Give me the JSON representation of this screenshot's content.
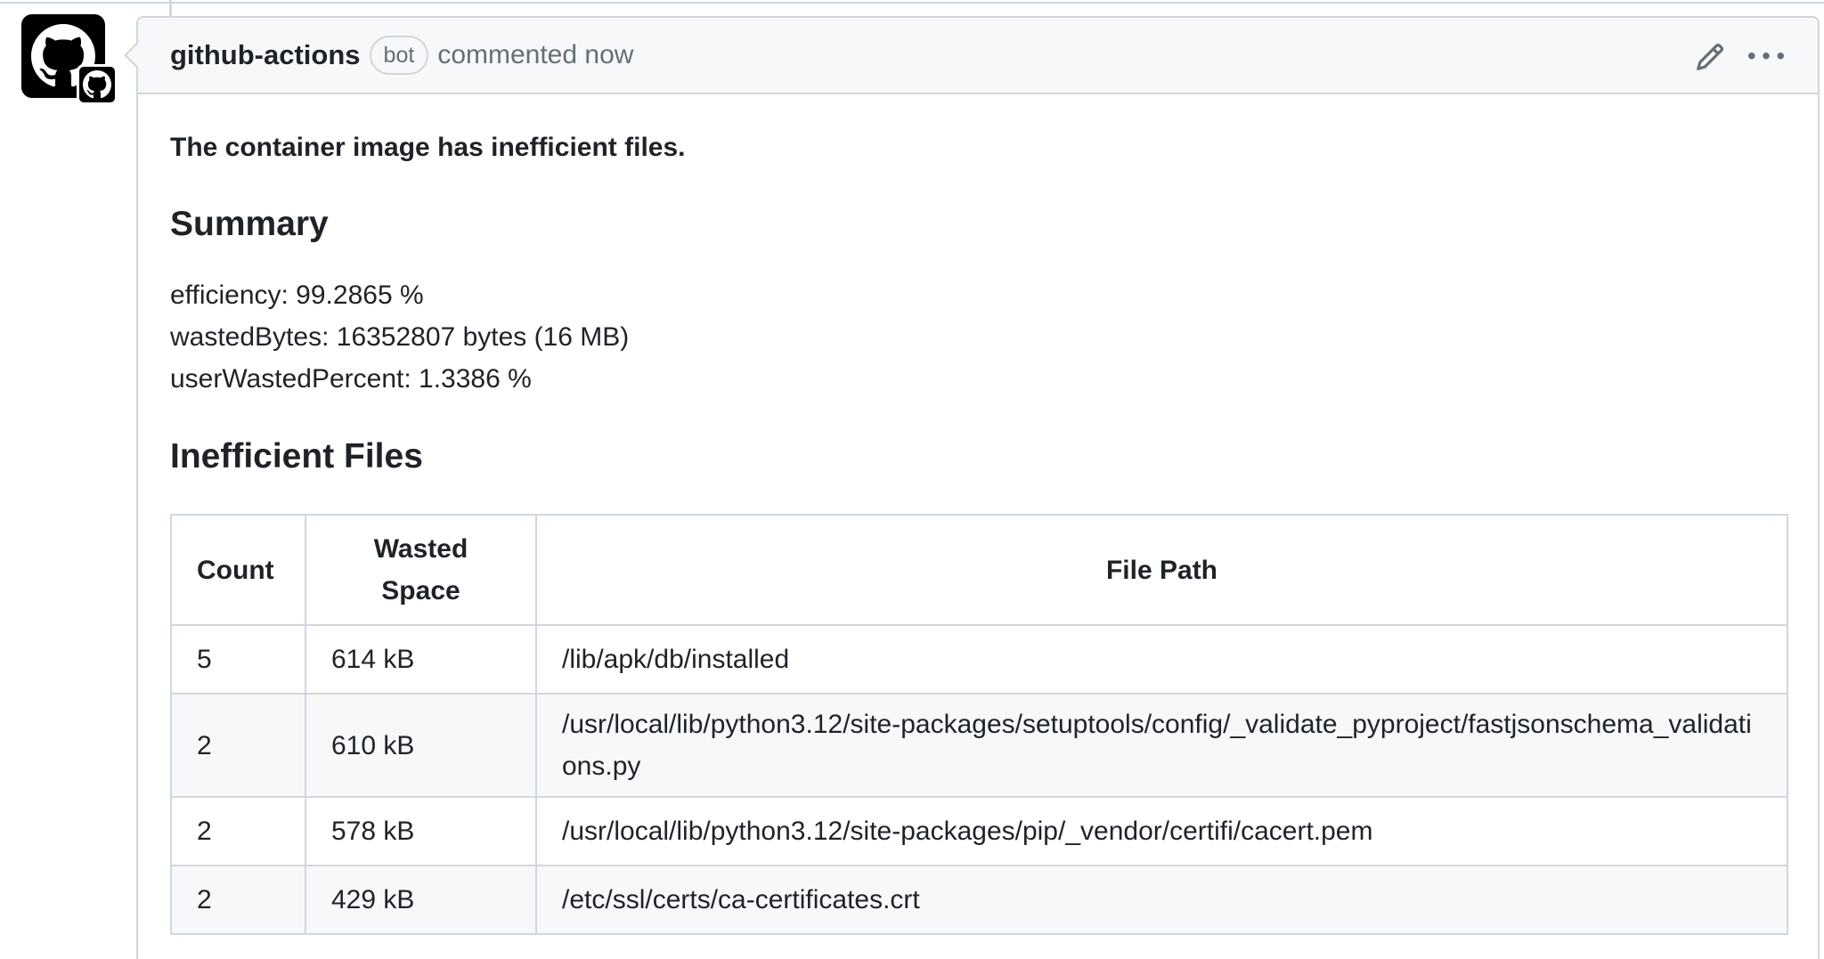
{
  "comment": {
    "author": "github-actions",
    "author_badge": "bot",
    "meta": "commented now",
    "lead": "The container image has inefficient files.",
    "summary_heading": "Summary",
    "metrics": [
      "efficiency: 99.2865 %",
      "wastedBytes: 16352807 bytes (16 MB)",
      "userWastedPercent: 1.3386 %"
    ],
    "files_heading": "Inefficient Files",
    "table": {
      "headers": [
        "Count",
        "Wasted Space",
        "File Path"
      ],
      "rows": [
        {
          "count": "5",
          "wasted": "614 kB",
          "path": "/lib/apk/db/installed"
        },
        {
          "count": "2",
          "wasted": "610 kB",
          "path": "/usr/local/lib/python3.12/site-packages/setuptools/config/_validate_pyproject/fastjsonschema_validations.py"
        },
        {
          "count": "2",
          "wasted": "578 kB",
          "path": "/usr/local/lib/python3.12/site-packages/pip/_vendor/certifi/cacert.pem"
        },
        {
          "count": "2",
          "wasted": "429 kB",
          "path": "/etc/ssl/certs/ca-certificates.crt"
        }
      ]
    }
  },
  "icons": {
    "avatar": "github-mark-icon",
    "edit": "pencil-icon",
    "more": "kebab-horizontal-icon"
  },
  "colors": {
    "border": "#d0d7de",
    "header_bg": "#f6f8fa",
    "text": "#1f2328",
    "muted": "#656d76"
  }
}
